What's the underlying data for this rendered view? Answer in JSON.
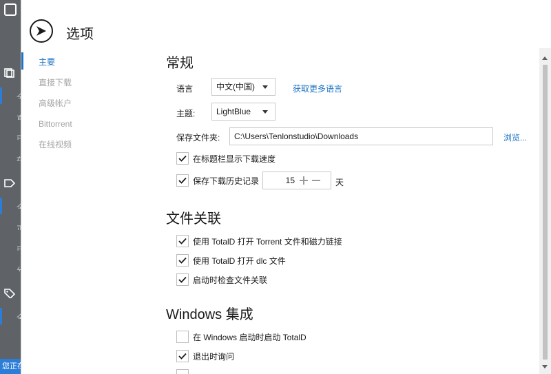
{
  "background": {
    "fragments": [
      "全",
      "直",
      "已",
      "在",
      "全",
      "正",
      "已",
      "分",
      "全"
    ],
    "status_text": "您正在"
  },
  "dialog": {
    "title": "选项"
  },
  "nav": {
    "items": [
      {
        "label": "主要",
        "active": true
      },
      {
        "label": "直接下载",
        "active": false
      },
      {
        "label": "高级帐户",
        "active": false
      },
      {
        "label": "Bittorrent",
        "active": false
      },
      {
        "label": "在线视频",
        "active": false
      }
    ]
  },
  "general": {
    "title": "常规",
    "language_label": "语言",
    "language_value": "中文(中国)",
    "more_languages_link": "获取更多语言",
    "theme_label": "主题:",
    "theme_value": "LightBlue",
    "save_folder_label": "保存文件夹:",
    "save_folder_value": "C:\\Users\\Tenlonstudio\\Downloads",
    "browse_link": "浏览...",
    "show_speed_label": "在标题栏显示下载速度",
    "show_speed_checked": true,
    "keep_history_label": "保存下载历史记录",
    "keep_history_checked": true,
    "history_days_value": "15",
    "history_days_unit": "天"
  },
  "file_assoc": {
    "title": "文件关联",
    "items": [
      {
        "label": "使用 TotalD 打开 Torrent 文件和磁力链接",
        "checked": true
      },
      {
        "label": "使用 TotalD 打开 dlc 文件",
        "checked": true
      },
      {
        "label": "启动时检查文件关联",
        "checked": true
      }
    ]
  },
  "windows": {
    "title": "Windows 集成",
    "items": [
      {
        "label": "在 Windows 启动时启动 TotalD",
        "checked": false
      },
      {
        "label": "退出时询问",
        "checked": true
      }
    ]
  },
  "colors": {
    "accent": "#1e74c4",
    "nav_inactive": "#a4a4a4",
    "background_app": "#5f6368"
  }
}
